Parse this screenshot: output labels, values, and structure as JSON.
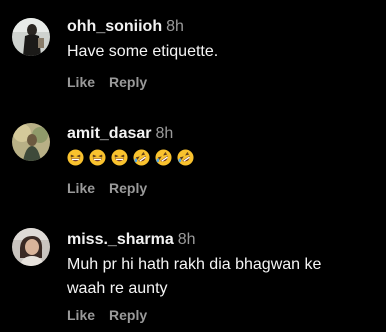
{
  "comments": [
    {
      "username": "ohh_soniioh",
      "time": "8h",
      "text": "Have some etiquette.",
      "like_label": "Like",
      "reply_label": "Reply",
      "avatar_icon": "user-avatar-photo"
    },
    {
      "username": "amit_dasar",
      "time": "8h",
      "emojis": [
        "grinning-squinting-face-icon",
        "grinning-squinting-face-icon",
        "grinning-squinting-face-icon",
        "rolling-on-floor-laughing-icon",
        "rolling-on-floor-laughing-icon",
        "rolling-on-floor-laughing-icon"
      ],
      "like_label": "Like",
      "reply_label": "Reply",
      "avatar_icon": "user-avatar-photo"
    },
    {
      "username": "miss._sharma",
      "time": "8h",
      "text_line1": "Muh pr hi hath rakh dia bhagwan ke",
      "text_line2": "waah re aunty",
      "like_label": "Like",
      "reply_label": "Reply",
      "avatar_icon": "user-avatar-photo"
    }
  ],
  "colors": {
    "background": "#000000",
    "username": "#f2f2f2",
    "secondary_text": "#9a9a9a",
    "emoji_yellow": "#f9c22e"
  }
}
